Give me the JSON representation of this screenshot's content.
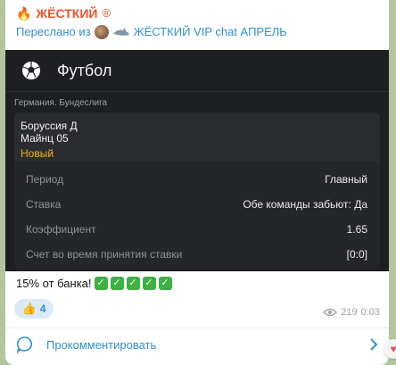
{
  "channel": {
    "name": "ЖЁСТКИЙ",
    "registered_symbol": "®",
    "icon": "fire-icon"
  },
  "forwarded": {
    "prefix": "Переслано из",
    "source": "ЖЁСТКИЙ VIP chat АПРЕЛЬ"
  },
  "card": {
    "sport": "Футбол",
    "league": "Германия. Бундеслига",
    "team1": "Боруссия Д",
    "team2": "Майнц 05",
    "status": "Новый",
    "rows": [
      {
        "key": "Период",
        "value": "Главный"
      },
      {
        "key": "Ставка",
        "value": "Обе команды забьют: Да"
      },
      {
        "key": "Коэффициент",
        "value": "1.65"
      },
      {
        "key": "Счет во время принятия ставки",
        "value": "[0:0]"
      }
    ]
  },
  "message": {
    "text": "15% от банка!",
    "check_count": 5
  },
  "reaction": {
    "emoji": "👍",
    "count": "4"
  },
  "meta": {
    "views": "219",
    "time": "0:03"
  },
  "comments": {
    "label": "Прокомментировать"
  },
  "colors": {
    "accent": "#2f8fd0",
    "channel": "#e8542b",
    "status": "#f1b51c",
    "card_bg": "#1e1f22"
  }
}
